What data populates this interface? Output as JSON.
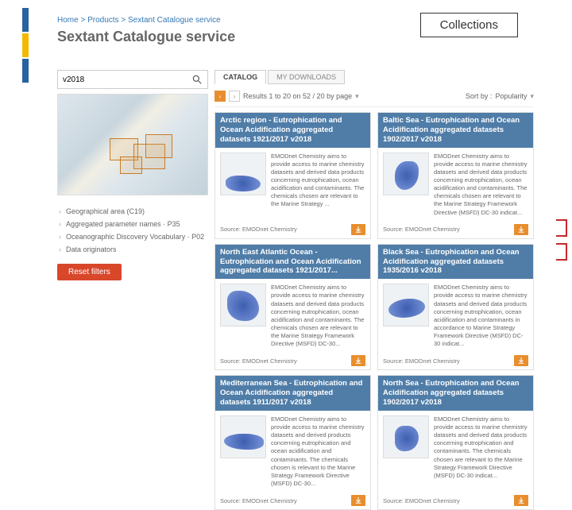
{
  "breadcrumb": [
    {
      "label": "Home"
    },
    {
      "label": "Products"
    },
    {
      "label": "Sextant Catalogue service"
    }
  ],
  "page_title": "Sextant Catalogue service",
  "collections_label": "Collections",
  "search": {
    "value": "v2018",
    "icon": "search"
  },
  "facets": [
    {
      "label": "Geographical area (C19)"
    },
    {
      "label": "Aggregated parameter names · P35"
    },
    {
      "label": "Oceanographic Discovery Vocabulary · P02"
    },
    {
      "label": "Data originators"
    }
  ],
  "reset_label": "Reset filters",
  "tabs": {
    "active": "CATALOG",
    "other": "MY DOWNLOADS"
  },
  "results_text": "Results 1 to 20 on 52 / 20 by page",
  "sort": {
    "label": "Sort by :",
    "value": "Popularity"
  },
  "cards": [
    {
      "title": "Arctic region - Eutrophication and Ocean Acidification aggregated datasets 1921/2017 v2018",
      "desc": "EMODnet Chemistry aims to provide access to marine chemistry datasets and derived data products concerning eutrophication, ocean acidification and contaminants. The chemicals chosen are relevant to the Marine Strategy ...",
      "source": "Source: EMODnet Chemistry"
    },
    {
      "title": "Baltic Sea - Eutrophication and Ocean Acidification aggregated datasets 1902/2017 v2018",
      "desc": "EMODnet Chemistry aims to provide access to marine chemistry datasets and derived data products concerning eutrophication, ocean acidification and contaminants. The chemicals chosen are relevant to the Marine Strategy Framework Directive (MSFD) DC-30 indicat...",
      "source": "Source: EMODnet Chemistry"
    },
    {
      "title": "North East Atlantic Ocean - Eutrophication and Ocean Acidification aggregated datasets 1921/2017...",
      "desc": "EMODnet Chemistry aims to provide access to marine chemistry datasets and derived data products concerning eutrophication, ocean acidification and contaminants. The chemicals chosen are relevant to the Marine Strategy Framework Directive (MSFD) DC-30...",
      "source": "Source: EMODnet Chemistry"
    },
    {
      "title": "Black Sea - Eutrophication and Ocean Acidification aggregated datasets 1935/2016 v2018",
      "desc": "EMODnet Chemistry aims to provide access to marine chemistry datasets and derived data products concerning eutrophication, ocean acidification and contaminants in accordance to Marine Strategy Framework Directive (MSFD) DC-30 indicat...",
      "source": "Source: EMODnet Chemistry"
    },
    {
      "title": "Mediterranean Sea - Eutrophication and Ocean Acidification aggregated datasets 1911/2017 v2018",
      "desc": "EMODnet Chemistry aims to provide access to marine chemistry datasets and derived products concerning eutrophication and ocean acidification and contaminants. The chemicals chosen is relevant to the Marine Strategy Framework Directive (MSFD) DC-30...",
      "source": "Source: EMODnet Chemistry"
    },
    {
      "title": "North Sea - Eutrophication and Ocean Acidification aggregated datasets 1902/2017 v2018",
      "desc": "EMODnet Chemistry aims to provide access to marine chemistry datasets and derived data products concerning eutrophication and contaminants. The chemicals chosen are relevant to the Marine Strategy Framework Directive (MSFD) DC-30 indicat...",
      "source": "Source: EMODnet Chemistry"
    }
  ]
}
